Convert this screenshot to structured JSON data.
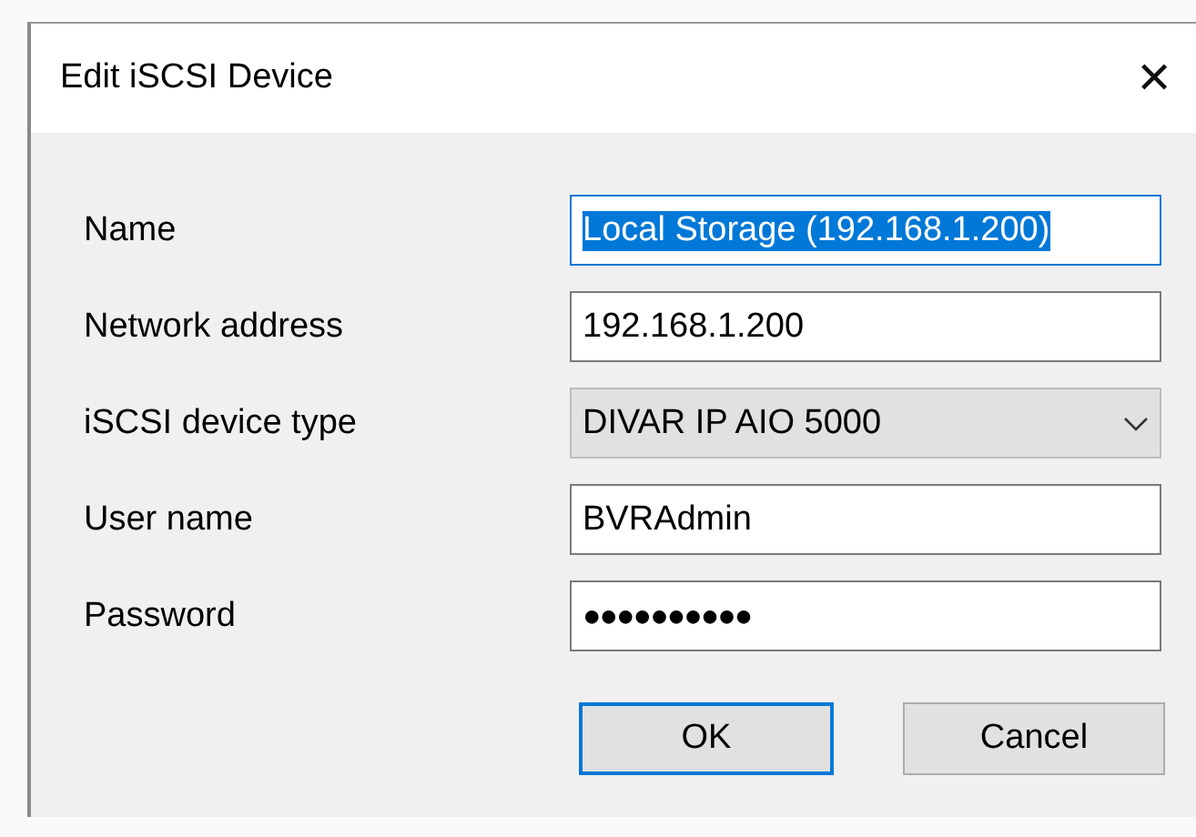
{
  "window": {
    "title": "Edit iSCSI Device",
    "close": "✕"
  },
  "fields": [
    {
      "label": "Name",
      "kind": "text",
      "value": "Local Storage (192.168.1.200)",
      "focused": true
    },
    {
      "label": "Network address",
      "kind": "text",
      "value": "192.168.1.200",
      "focused": false
    },
    {
      "label": "iSCSI device type",
      "kind": "dropdown",
      "value": "DIVAR IP AIO 5000",
      "focused": false
    },
    {
      "label": "User name",
      "kind": "text",
      "value": "BVRAdmin",
      "focused": false
    },
    {
      "label": "Password",
      "kind": "password",
      "value": "●●●●●●●●●●",
      "focused": false
    }
  ],
  "buttons": [
    {
      "label": "OK",
      "default": true
    },
    {
      "label": "Cancel",
      "default": false
    }
  ]
}
